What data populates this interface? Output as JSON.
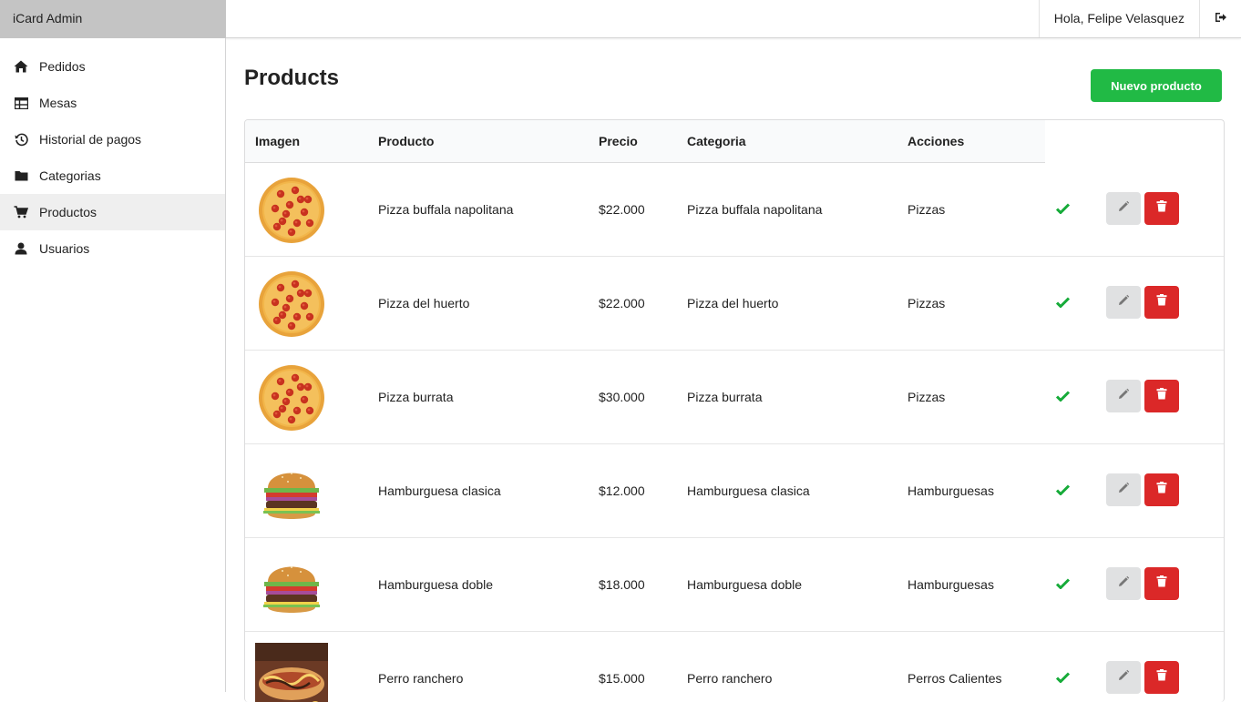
{
  "header": {
    "brand": "iCard Admin",
    "greeting": "Hola, Felipe Velasquez",
    "logout_icon": "sign-out-icon"
  },
  "sidebar": {
    "items": [
      {
        "label": "Pedidos",
        "icon": "home-icon",
        "active": false
      },
      {
        "label": "Mesas",
        "icon": "table-icon",
        "active": false
      },
      {
        "label": "Historial de pagos",
        "icon": "history-icon",
        "active": false
      },
      {
        "label": "Categorias",
        "icon": "folder-icon",
        "active": false
      },
      {
        "label": "Productos",
        "icon": "cart-icon",
        "active": true
      },
      {
        "label": "Usuarios",
        "icon": "user-icon",
        "active": false
      }
    ]
  },
  "main": {
    "title": "Products",
    "new_button": "Nuevo producto",
    "columns": [
      "Imagen",
      "Producto",
      "Precio",
      "Categoria",
      "Acciones"
    ],
    "rows": [
      {
        "image": "pizza",
        "producto": "Pizza buffala napolitana",
        "precio": "$22.000",
        "categoria": "Pizza buffala napolitana",
        "acciones": "Pizzas"
      },
      {
        "image": "pizza",
        "producto": "Pizza del huerto",
        "precio": "$22.000",
        "categoria": "Pizza del huerto",
        "acciones": "Pizzas"
      },
      {
        "image": "pizza",
        "producto": "Pizza burrata",
        "precio": "$30.000",
        "categoria": "Pizza burrata",
        "acciones": "Pizzas"
      },
      {
        "image": "burger",
        "producto": "Hamburguesa clasica",
        "precio": "$12.000",
        "categoria": "Hamburguesa clasica",
        "acciones": "Hamburguesas"
      },
      {
        "image": "burger",
        "producto": "Hamburguesa doble",
        "precio": "$18.000",
        "categoria": "Hamburguesa doble",
        "acciones": "Hamburguesas"
      },
      {
        "image": "hotdog",
        "producto": "Perro ranchero",
        "precio": "$15.000",
        "categoria": "Perro ranchero",
        "acciones": "Perros Calientes"
      }
    ]
  },
  "colors": {
    "primary_green": "#21ba45",
    "check_green": "#16ab39",
    "delete_red": "#db2828",
    "edit_grey": "#e0e1e2",
    "brand_bg": "#c4c4c4",
    "active_item_bg": "#efefef"
  }
}
